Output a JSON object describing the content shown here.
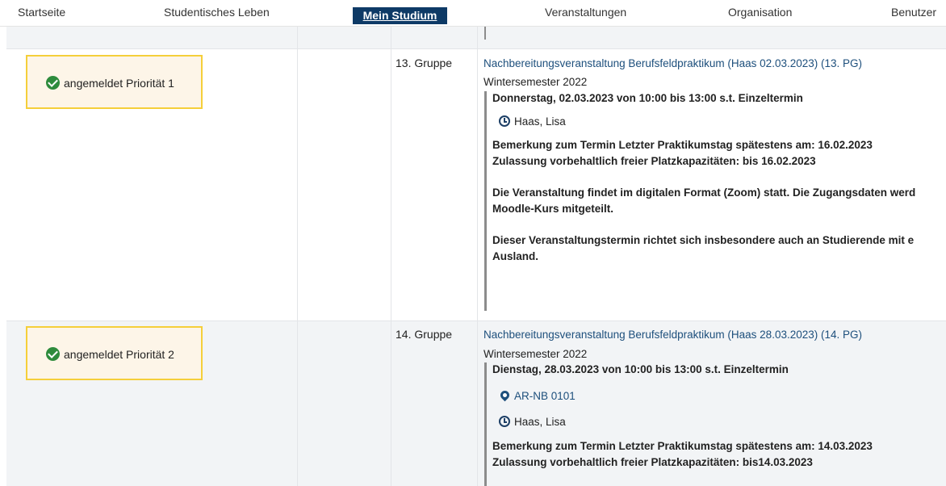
{
  "nav": {
    "items": [
      {
        "label": "Startseite"
      },
      {
        "label": "Studentisches Leben"
      },
      {
        "label": "Mein Studium"
      },
      {
        "label": "Veranstaltungen"
      },
      {
        "label": "Organisation"
      },
      {
        "label": "Benutzer"
      }
    ]
  },
  "rows": [
    {
      "status": "angemeldet Priorität 1",
      "group": "13. Gruppe",
      "title": "Nachbereitungsveranstaltung Berufsfeldpraktikum (Haas 02.03.2023) (13. PG)",
      "semester": "Wintersemester 2022",
      "date_line": "Donnerstag, 02.03.2023 von 10:00 bis 13:00 s.t. Einzeltermin",
      "lecturer": "Haas, Lisa",
      "remark_line1": "Bemerkung zum Termin Letzter Praktikumstag spätestens am: 16.02.2023",
      "remark_line2": "Zulassung vorbehaltlich freier Platzkapazitäten: bis 16.02.2023",
      "info1_line1": "Die Veranstaltung findet im digitalen Format (Zoom) statt. Die Zugangsdaten werd",
      "info1_line2": "Moodle-Kurs mitgeteilt.",
      "info2_line1": "Dieser Veranstaltungstermin richtet sich insbesondere auch an Studierende mit e",
      "info2_line2": "Ausland."
    },
    {
      "status": "angemeldet Priorität 2",
      "group": "14. Gruppe",
      "title": "Nachbereitungsveranstaltung Berufsfeldpraktikum (Haas 28.03.2023) (14. PG)",
      "semester": "Wintersemester 2022",
      "date_line": "Dienstag, 28.03.2023 von 10:00 bis 13:00 s.t. Einzeltermin",
      "room": "AR-NB 0101",
      "lecturer": "Haas, Lisa",
      "remark_line1": "Bemerkung zum Termin Letzter Praktikumstag spätestens am: 14.03.2023",
      "remark_line2": "Zulassung vorbehaltlich freier Platzkapazitäten: bis14.03.2023"
    }
  ],
  "colors": {
    "nav_active_bg": "#0e3a66",
    "status_border": "#f5cf3a",
    "status_bg": "#fdf5e8",
    "check_green": "#2e8b3c",
    "link_blue": "#1d4f7c"
  }
}
